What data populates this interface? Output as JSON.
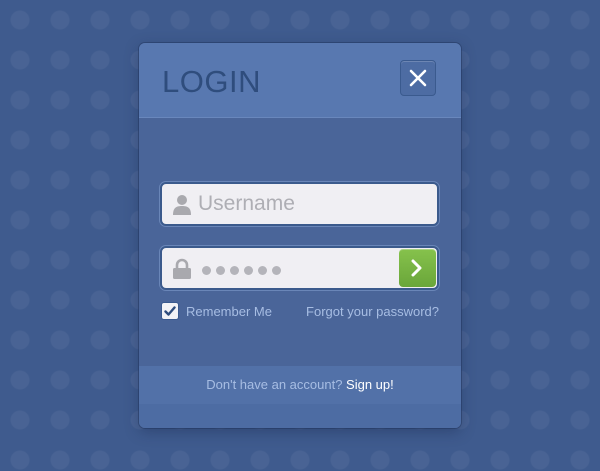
{
  "login_dialog": {
    "title": "LOGIN",
    "close_icon": "close-icon",
    "username": {
      "icon": "user-icon",
      "placeholder": "Username",
      "value": ""
    },
    "password": {
      "icon": "lock-icon",
      "masked_value": "••••••",
      "submit_icon": "chevron-right-icon"
    },
    "remember_me": {
      "label": "Remember Me",
      "checked": true
    },
    "forgot_password": "Forgot your password?",
    "footer": {
      "prompt": "Don't have an account?",
      "signup_label": "Sign up!"
    },
    "colors": {
      "background": "#3f5b8e",
      "header": "#5878b0",
      "submit_button": "#78b443",
      "link_text": "#a7bde3"
    }
  }
}
